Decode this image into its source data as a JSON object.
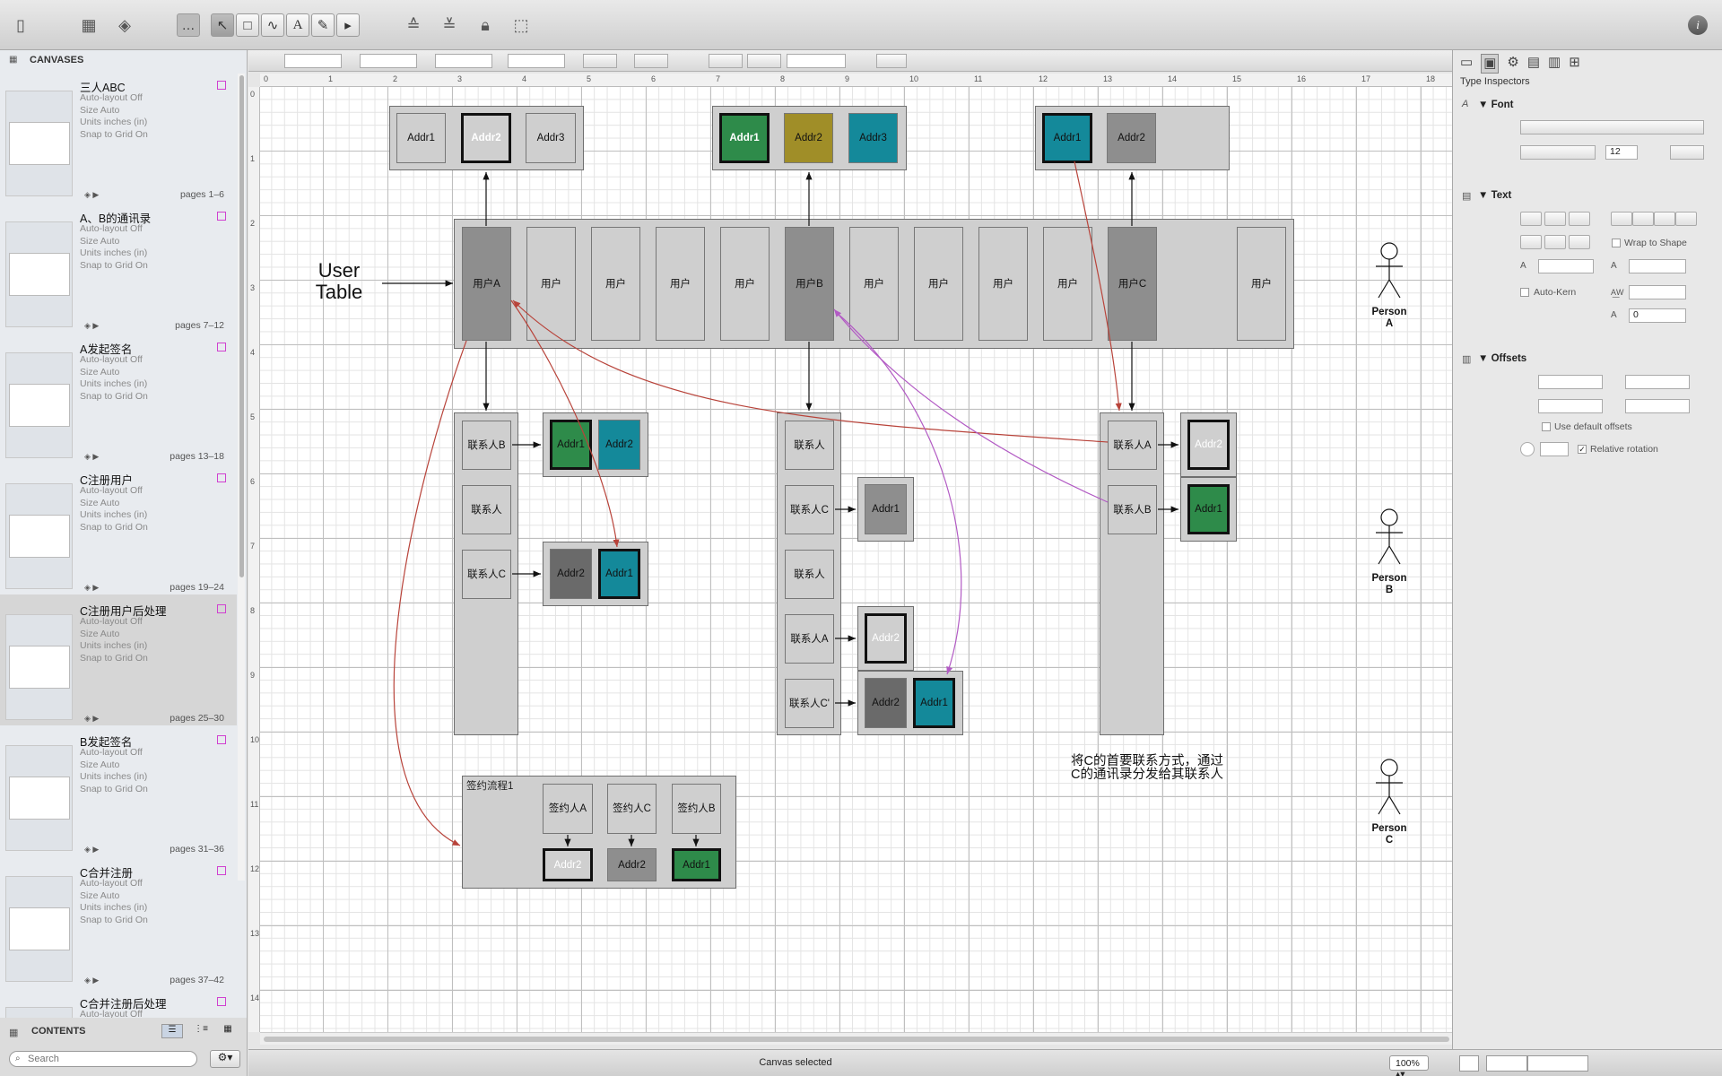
{
  "toolbar": {
    "tool_icons": [
      "sidebar-toggle-icon",
      "canvas-icon",
      "layers-icon",
      "style-icon",
      "selection-tool-icon",
      "shape-tool-icon",
      "line-tool-icon",
      "text-tool-icon",
      "pen-tool-icon",
      "diagram-tool-icon",
      "bring-front-icon",
      "send-back-icon",
      "lock-icon",
      "group-icon",
      "info-icon"
    ]
  },
  "sidebar": {
    "header": "CANVASES",
    "canvases": [
      {
        "name": "三人ABC",
        "meta": [
          "Auto-layout Off",
          "Size Auto",
          "Units inches (in)",
          "Snap to Grid On"
        ],
        "pages": "pages 1–6"
      },
      {
        "name": "A、B的通讯录",
        "meta": [
          "Auto-layout Off",
          "Size Auto",
          "Units inches (in)",
          "Snap to Grid On"
        ],
        "pages": "pages 7–12"
      },
      {
        "name": "A发起签名",
        "meta": [
          "Auto-layout Off",
          "Size Auto",
          "Units inches (in)",
          "Snap to Grid On"
        ],
        "pages": "pages 13–18"
      },
      {
        "name": "C注册用户",
        "meta": [
          "Auto-layout Off",
          "Size Auto",
          "Units inches (in)",
          "Snap to Grid On"
        ],
        "pages": "pages 19–24"
      },
      {
        "name": "C注册用户后处理",
        "meta": [
          "Auto-layout Off",
          "Size Auto",
          "Units inches (in)",
          "Snap to Grid On"
        ],
        "pages": "pages 25–30"
      },
      {
        "name": "B发起签名",
        "meta": [
          "Auto-layout Off",
          "Size Auto",
          "Units inches (in)",
          "Snap to Grid On"
        ],
        "pages": "pages 31–36"
      },
      {
        "name": "C合并注册",
        "meta": [
          "Auto-layout Off",
          "Size Auto",
          "Units inches (in)",
          "Snap to Grid On"
        ],
        "pages": "pages 37–42"
      },
      {
        "name": "C合并注册后处理",
        "meta": [
          "Auto-layout Off"
        ],
        "pages": ""
      }
    ],
    "contents_label": "CONTENTS",
    "search_placeholder": "Search"
  },
  "ruler": {
    "top": [
      "0",
      "1",
      "2",
      "3",
      "4",
      "5",
      "6",
      "7",
      "8",
      "9",
      "10",
      "11",
      "12",
      "13",
      "14",
      "15",
      "16",
      "17",
      "18"
    ],
    "left": [
      "0",
      "1",
      "2",
      "3",
      "4",
      "5",
      "6",
      "7",
      "8",
      "9",
      "10",
      "11",
      "12",
      "13",
      "14"
    ]
  },
  "diagram": {
    "addr_groups": [
      {
        "cells": [
          {
            "t": "Addr1"
          },
          {
            "t": "Addr2",
            "style": "thick-white"
          },
          {
            "t": "Addr3"
          }
        ]
      },
      {
        "cells": [
          {
            "t": "Addr1",
            "color": "#2e8b4a"
          },
          {
            "t": "Addr2",
            "color": "#a08e28"
          },
          {
            "t": "Addr3",
            "color": "#14899a"
          }
        ]
      },
      {
        "cells": [
          {
            "t": "Addr1",
            "color": "#14899a"
          },
          {
            "t": "Addr2",
            "color": "#8e8e8e"
          }
        ]
      }
    ],
    "user_table_label": [
      "User",
      "Table"
    ],
    "users": [
      "用户A",
      "用户",
      "用户",
      "用户",
      "用户",
      "用户B",
      "用户",
      "用户",
      "用户",
      "用户",
      "用户C",
      "用户"
    ],
    "contacts_a": [
      "联系人B",
      "联系人",
      "联系人C"
    ],
    "contacts_b": [
      "联系人",
      "联系人C",
      "联系人",
      "联系人A",
      "联系人C'"
    ],
    "contacts_c": [
      "联系人A",
      "联系人B"
    ],
    "addr_a_b": [
      "Addr1",
      "Addr2"
    ],
    "addr_a_c": [
      "Addr2",
      "Addr1"
    ],
    "addr_b_c": "Addr1",
    "addr_b_a": "Addr2",
    "addr_b_cp": [
      "Addr2",
      "Addr1"
    ],
    "addr_c_a": "Addr2",
    "addr_c_b": "Addr1",
    "sign_flow": {
      "title": "签约流程1",
      "signers": [
        "签约人A",
        "签约人C",
        "签约人B"
      ],
      "addrs": [
        "Addr2",
        "Addr2",
        "Addr1"
      ]
    },
    "note": [
      "将C的首要联系方式，通过",
      "C的通讯录分发给其联系人"
    ],
    "persons": [
      [
        "Person",
        "A"
      ],
      [
        "Person",
        "B"
      ],
      [
        "Person",
        "C"
      ]
    ],
    "colors": {
      "green": "#2e8b4a",
      "olive": "#a08e28",
      "teal": "#14899a",
      "gray": "#cfcfcf",
      "dark": "#8e8e8e",
      "darker": "#6a6a6a",
      "red_line": "#b8433a",
      "purple_line": "#b25ac4"
    }
  },
  "status": {
    "text": "Canvas selected",
    "zoom": "100%"
  },
  "inspector": {
    "title": "Type Inspectors",
    "font": {
      "header": "Font",
      "size": "12"
    },
    "text": {
      "header": "Text",
      "wrap": "Wrap to Shape",
      "kern": "Auto-Kern",
      "baseline": "0"
    },
    "offsets": {
      "header": "Offsets",
      "use_default": "Use default offsets",
      "relative": "Relative rotation"
    }
  }
}
